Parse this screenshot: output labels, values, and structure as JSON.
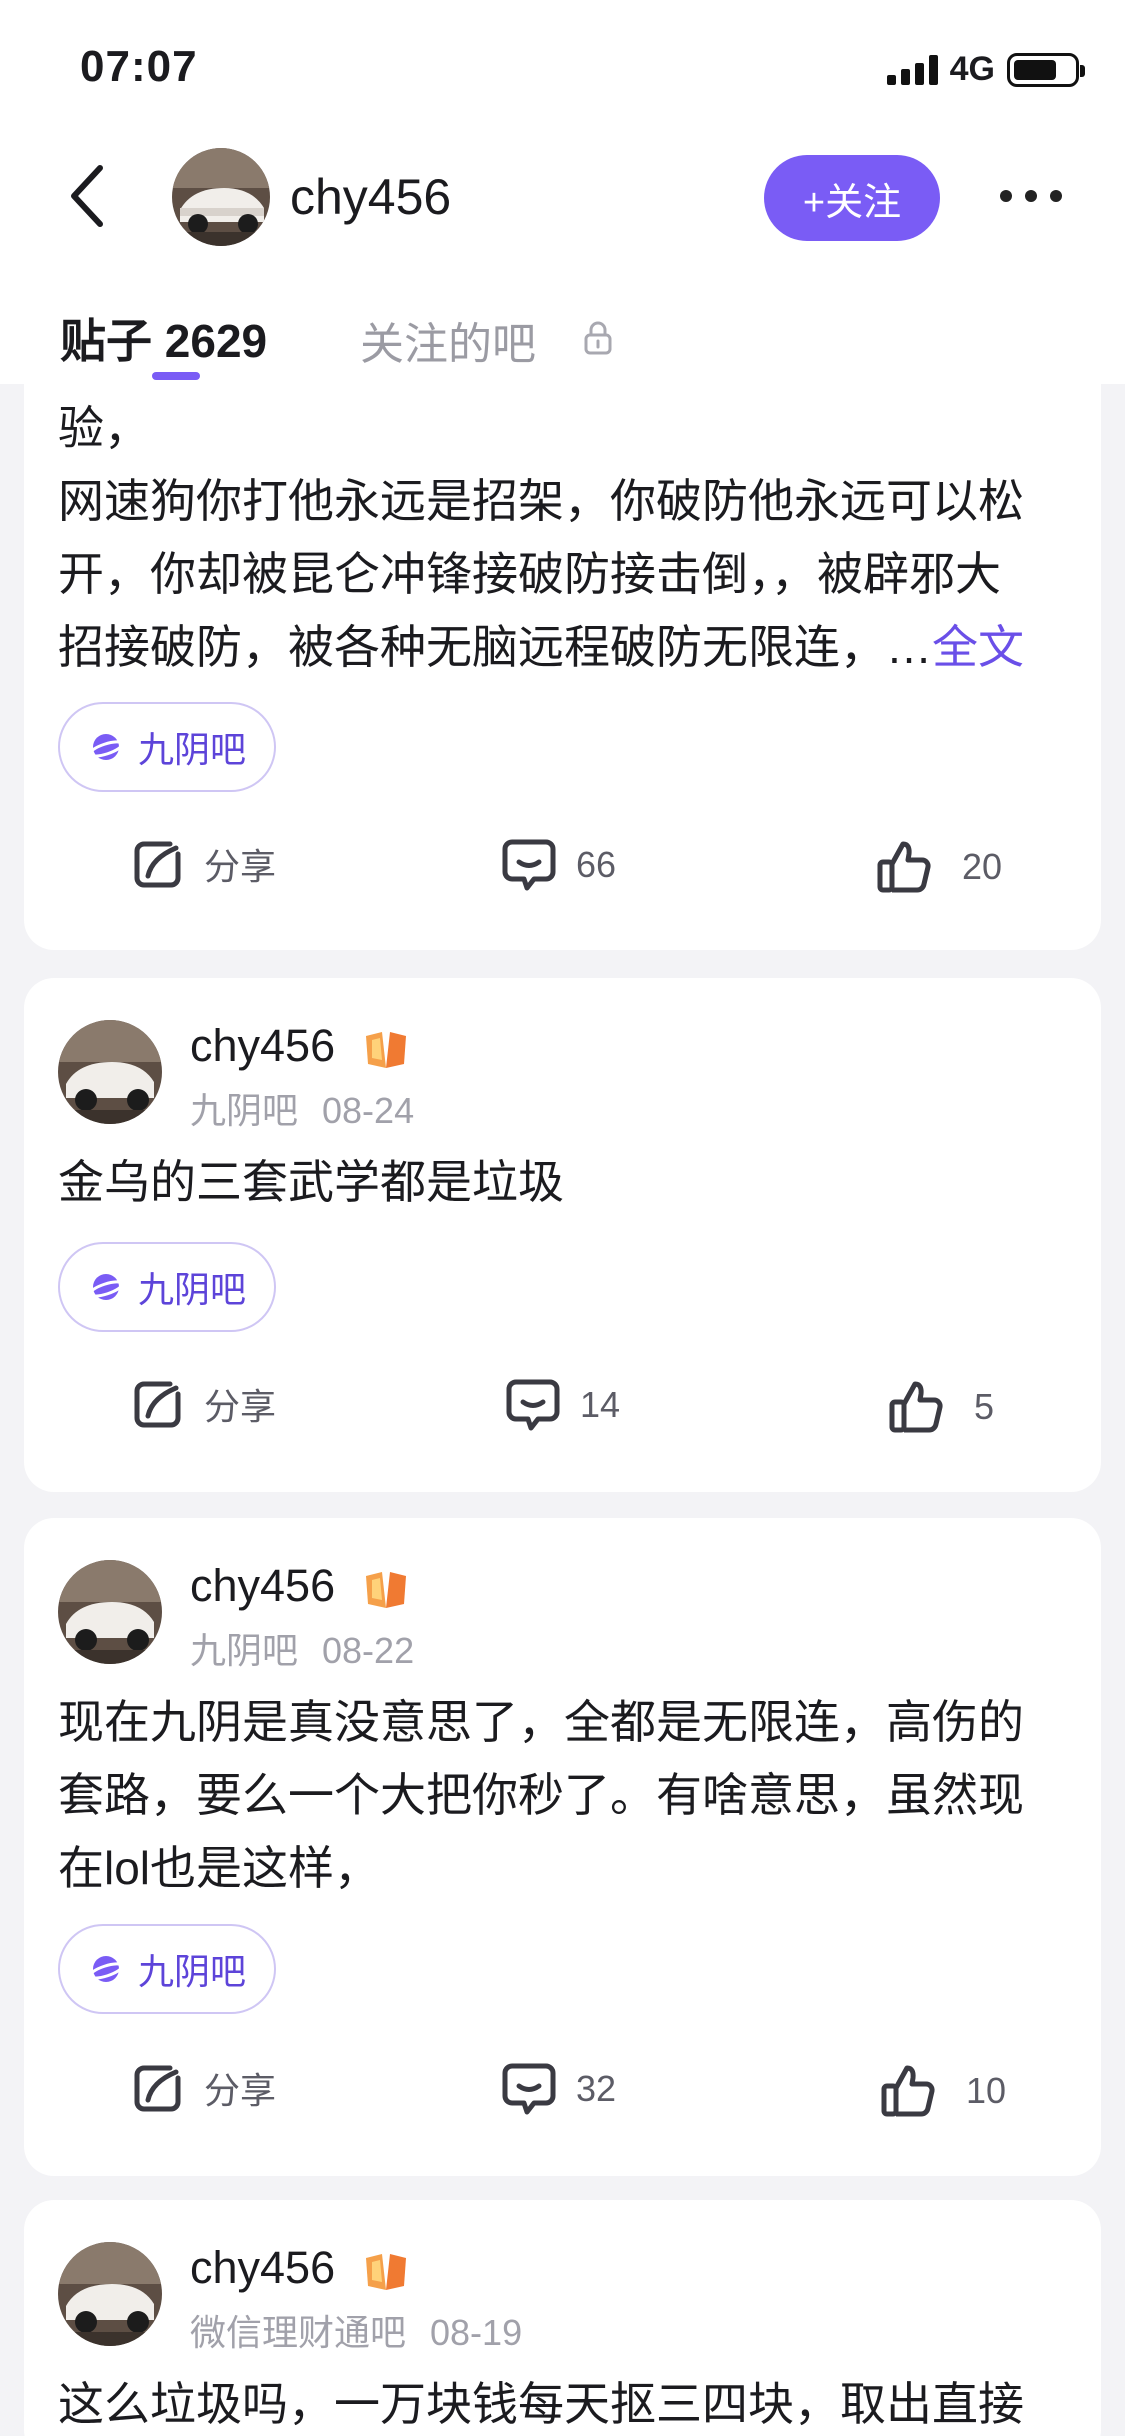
{
  "status_bar": {
    "time": "07:07",
    "network": "4G"
  },
  "header": {
    "username": "chy456",
    "follow_label": "+关注"
  },
  "tabs": {
    "posts_label": "贴子 2629",
    "following_bars_label": "关注的吧"
  },
  "colors": {
    "accent": "#7a5cf5",
    "link": "#6a4fe8",
    "background": "#f3f3f6"
  },
  "posts": [
    {
      "text": "验，\n网速狗你打他永远是招架，你破防他永远可以松\n开，你却被昆仑冲锋接破防接击倒，，被辟邪大\n招接破防，被各种无脑远程破防无限连，…",
      "more_label": "全文",
      "tag": "九阴吧",
      "share_label": "分享",
      "comments": "66",
      "likes": "20"
    },
    {
      "username": "chy456",
      "forum": "九阴吧",
      "date": "08-24",
      "text": "金乌的三套武学都是垃圾",
      "tag": "九阴吧",
      "share_label": "分享",
      "comments": "14",
      "likes": "5"
    },
    {
      "username": "chy456",
      "forum": "九阴吧",
      "date": "08-22",
      "text": "现在九阴是真没意思了，全都是无限连，高伤的\n套路，要么一个大把你秒了。有啥意思，虽然现\n在lol也是这样，",
      "tag": "九阴吧",
      "share_label": "分享",
      "comments": "32",
      "likes": "10"
    },
    {
      "username": "chy456",
      "forum": "微信理财通吧",
      "date": "08-19",
      "text": "这么垃圾吗，一万块钱每天抠三四块，取出直接"
    }
  ]
}
